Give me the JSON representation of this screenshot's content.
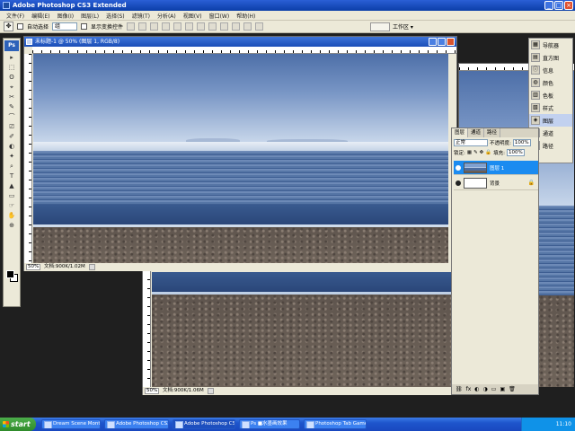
{
  "app": {
    "title": "Adobe Photoshop CS3 Extended",
    "window_buttons": [
      "_",
      "□",
      "×"
    ]
  },
  "menu": {
    "items": [
      "文件(F)",
      "编辑(E)",
      "图像(I)",
      "图层(L)",
      "选择(S)",
      "滤镜(T)",
      "分析(A)",
      "视图(V)",
      "窗口(W)",
      "帮助(H)"
    ]
  },
  "options": {
    "auto_select_label": "自动选择",
    "auto_select_value": "组",
    "show_transform_label": "显示变换控件",
    "workspace_label": "工作区 ▾"
  },
  "toolbox": {
    "logo": "Ps",
    "tools": [
      "▸",
      "⬚",
      "ʘ",
      "⌖",
      "✂",
      "✎",
      "⌒",
      "⎚",
      "✐",
      "◐",
      "✦",
      "⌕",
      "T",
      "▲",
      "▭",
      "☞",
      "✋",
      "⊕"
    ]
  },
  "doc_main": {
    "title": "未标题-1 @ 50% (图层 1, RGB/8)",
    "zoom": "50%",
    "status": "文档:900K/1.02M"
  },
  "doc_back": {
    "zoom": "50%",
    "status": "文档:900K/1.06M"
  },
  "dock": {
    "items": [
      {
        "icon": "▦",
        "label": "导航器"
      },
      {
        "icon": "▤",
        "label": "直方图"
      },
      {
        "icon": "ⓘ",
        "label": "信息"
      },
      {
        "icon": "◍",
        "label": "颜色"
      },
      {
        "icon": "▥",
        "label": "色板"
      },
      {
        "icon": "▧",
        "label": "样式"
      },
      {
        "icon": "◈",
        "label": "图层"
      },
      {
        "icon": "◎",
        "label": "通道"
      },
      {
        "icon": "⟋",
        "label": "路径"
      }
    ],
    "active_index": 6
  },
  "layers_panel": {
    "tabs": [
      "图层",
      "通道",
      "路径"
    ],
    "blend_mode": "正常",
    "opacity_label": "不透明度:",
    "opacity_value": "100%",
    "lock_label": "锁定:",
    "fill_label": "填充:",
    "fill_value": "100%",
    "layers": [
      {
        "name": "图层 1",
        "selected": true
      },
      {
        "name": "背景",
        "selected": false,
        "locked": true
      }
    ],
    "bottom_icons": [
      "⛓",
      "fx",
      "◐",
      "◑",
      "▭",
      "▣",
      "🗑"
    ]
  },
  "taskbar": {
    "start_label": "start",
    "tasks": [
      {
        "label": "Dream Scene Montage",
        "active": false
      },
      {
        "label": "Adobe Photoshop CS3 ...",
        "active": false
      },
      {
        "label": "Adobe Photoshop CS...",
        "active": true
      },
      {
        "label": "Ps ■水墨画效果",
        "active": false
      },
      {
        "label": "Photoshop Tab Game...",
        "active": false
      }
    ],
    "clock": "11:10"
  }
}
